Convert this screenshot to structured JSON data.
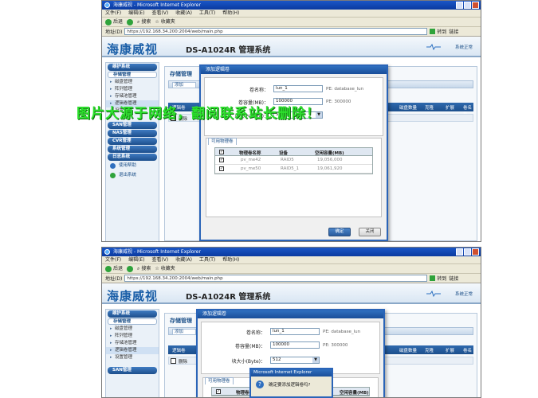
{
  "browser": {
    "window_title": "海康威视 - Microsoft Internet Explorer",
    "menu": [
      "文件(F)",
      "编辑(E)",
      "查看(V)",
      "收藏(A)",
      "工具(T)",
      "帮助(H)"
    ],
    "toolbar": {
      "back": "后退",
      "search": "搜索",
      "favorites": "收藏夹"
    },
    "address_label": "地址(D)",
    "url_top": "https://192.168.34.200:2004/web/main.php",
    "url_bottom": "https://192.168.34.200:2004/web/main.php",
    "go_label": "转到",
    "links_label": "链接"
  },
  "app": {
    "brand": "海康威视",
    "model": "DS-A1024R 管理系统",
    "logout": "系统正常"
  },
  "sidebar": {
    "groups": [
      {
        "label": "维护系统"
      },
      {
        "label": "SAN管理"
      },
      {
        "label": "NAS管理"
      },
      {
        "label": "CVR管理"
      },
      {
        "label": "系统管理"
      },
      {
        "label": "日志系统"
      }
    ],
    "storage_sub": "存储管理",
    "storage_items": [
      "磁盘管理",
      "阵列管理",
      "存储池管理",
      "逻辑卷管理",
      "设置管理"
    ],
    "links": {
      "help": "使用帮助",
      "exit": "退出系统"
    }
  },
  "content": {
    "title": "存储管理",
    "tab_label": "逻辑卷",
    "add_label": "添加",
    "delete_label": "删除",
    "columns": [
      "磁盘数量",
      "克隆",
      "扩展",
      "卷名称"
    ]
  },
  "dialog": {
    "title": "添加逻辑卷",
    "volume_name_label": "卷名称：",
    "volume_name_value": "lun_1",
    "volume_name_hint": "PE: database_lun",
    "capacity_label": "卷容量(MB)：",
    "capacity_value": "100000",
    "capacity_hint": "PE: 300000",
    "block_label": "块大小(Byte)：",
    "block_value": "512",
    "pv_tab": "可用物理卷",
    "pv_columns": [
      "物理卷名称",
      "设备",
      "空闲容量(MB)"
    ],
    "pv_rows": [
      {
        "name": "pv_me42",
        "device": "RAID5",
        "free": "19,056,000"
      },
      {
        "name": "pv_me50",
        "device": "RAID5_1",
        "free": "19,061,920"
      }
    ],
    "ok_label": "确定",
    "cancel_label": "关闭"
  },
  "confirm": {
    "title": "Microsoft Internet Explorer",
    "message": "确定要添加逻辑卷吗?"
  },
  "watermark": "图片大源于网络，翻阅联系站长删除！",
  "colors": {
    "brand_blue": "#1b5fa8",
    "header_bar": "#1c4f8c",
    "watermark": "#2de02d"
  }
}
